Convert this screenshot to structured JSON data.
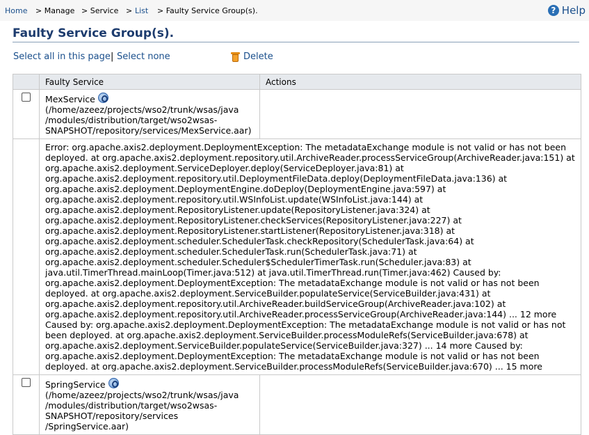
{
  "breadcrumb": {
    "home": "Home",
    "manage": "> Manage",
    "service": "> Service",
    "list_prefix": ">",
    "list": "List",
    "current": "> Faulty Service Group(s)."
  },
  "help": {
    "label": "Help"
  },
  "page_title": "Faulty Service Group(s).",
  "toolbar": {
    "select_all": "Select all in this page",
    "separator": "|",
    "select_none": "Select none",
    "delete": "Delete"
  },
  "table": {
    "headers": [
      "",
      "Faulty Service",
      "Actions"
    ],
    "rows": [
      {
        "name": "MexService",
        "path": "(/home/azeez/projects/wso2/trunk/wsas/java /modules/distribution/target/wso2wsas-SNAPSHOT/repository/services/MexService.aar)",
        "error": "Error: org.apache.axis2.deployment.DeploymentException: The metadataExchange module is not valid or has not been deployed. at org.apache.axis2.deployment.repository.util.ArchiveReader.processServiceGroup(ArchiveReader.java:151) at org.apache.axis2.deployment.ServiceDeployer.deploy(ServiceDeployer.java:81) at org.apache.axis2.deployment.repository.util.DeploymentFileData.deploy(DeploymentFileData.java:136) at org.apache.axis2.deployment.DeploymentEngine.doDeploy(DeploymentEngine.java:597) at org.apache.axis2.deployment.repository.util.WSInfoList.update(WSInfoList.java:144) at org.apache.axis2.deployment.RepositoryListener.update(RepositoryListener.java:324) at org.apache.axis2.deployment.RepositoryListener.checkServices(RepositoryListener.java:227) at org.apache.axis2.deployment.RepositoryListener.startListener(RepositoryListener.java:318) at org.apache.axis2.deployment.scheduler.SchedulerTask.checkRepository(SchedulerTask.java:64) at org.apache.axis2.deployment.scheduler.SchedulerTask.run(SchedulerTask.java:71) at org.apache.axis2.deployment.scheduler.Scheduler$SchedulerTimerTask.run(Scheduler.java:83) at java.util.TimerThread.mainLoop(Timer.java:512) at java.util.TimerThread.run(Timer.java:462) Caused by: org.apache.axis2.deployment.DeploymentException: The metadataExchange module is not valid or has not been deployed. at org.apache.axis2.deployment.ServiceBuilder.populateService(ServiceBuilder.java:431) at org.apache.axis2.deployment.repository.util.ArchiveReader.buildServiceGroup(ArchiveReader.java:102) at org.apache.axis2.deployment.repository.util.ArchiveReader.processServiceGroup(ArchiveReader.java:144) ... 12 more Caused by: org.apache.axis2.deployment.DeploymentException: The metadataExchange module is not valid or has not been deployed. at org.apache.axis2.deployment.ServiceBuilder.processModuleRefs(ServiceBuilder.java:678) at org.apache.axis2.deployment.ServiceBuilder.populateService(ServiceBuilder.java:327) ... 14 more Caused by: org.apache.axis2.deployment.DeploymentException: The metadataExchange module is not valid or has not been deployed. at org.apache.axis2.deployment.ServiceBuilder.processModuleRefs(ServiceBuilder.java:670) ... 15 more"
      },
      {
        "name": "SpringService",
        "path": "(/home/azeez/projects/wso2/trunk/wsas/java /modules/distribution/target/wso2wsas-SNAPSHOT/repository/services /SpringService.aar)"
      }
    ]
  },
  "colors": {
    "title": "#1d3c6e",
    "link": "#1a4f8c",
    "header_bg": "#e6e9ed"
  },
  "icons": {
    "help": "help-icon",
    "delete": "trash-icon",
    "service": "axis-service-icon"
  }
}
